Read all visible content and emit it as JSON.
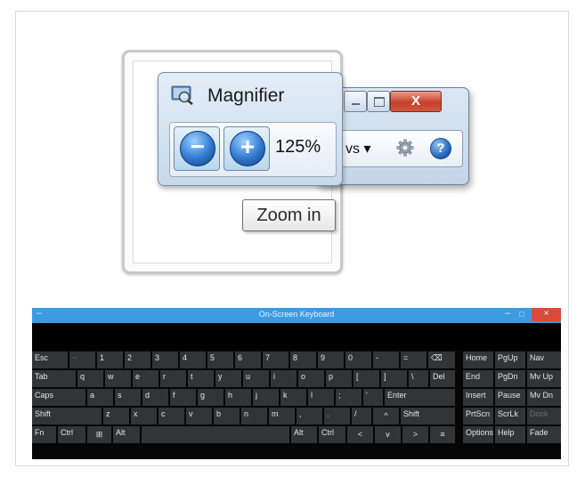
{
  "magnifier": {
    "title": "Magnifier",
    "zoom_level": "125%",
    "zoom_out_symbol": "−",
    "zoom_in_symbol": "+",
    "tooltip": "Zoom in",
    "views_label": "vs ▾",
    "close_symbol": "X",
    "help_symbol": "?",
    "icons": [
      "magnifier-app-icon",
      "gear-icon",
      "help-icon",
      "minimize-icon",
      "maximize-icon",
      "close-icon"
    ],
    "colors": {
      "close_button": "#c6402a",
      "zoom_orb": "#2f79cf",
      "window_frame": "#c7d9ec"
    }
  },
  "osk": {
    "title": "On-Screen Keyboard",
    "title_dash": "–",
    "minimize_symbol": "–",
    "maximize_symbol": "□",
    "close_symbol": "×",
    "colors": {
      "titlebar": "#3d9be1",
      "key": "#333436",
      "close": "#d94a3a"
    },
    "rows": [
      [
        "Esc",
        "~",
        "1",
        "2",
        "3",
        "4",
        "5",
        "6",
        "7",
        "8",
        "9",
        "0",
        "-",
        "=",
        "⌫"
      ],
      [
        "Tab",
        "q",
        "w",
        "e",
        "r",
        "t",
        "y",
        "u",
        "i",
        "o",
        "p",
        "[",
        "]",
        "\\",
        "Del"
      ],
      [
        "Caps",
        "a",
        "s",
        "d",
        "f",
        "g",
        "h",
        "j",
        "k",
        "l",
        ";",
        "'",
        "Enter"
      ],
      [
        "Shift",
        "z",
        "x",
        "c",
        "v",
        "b",
        "n",
        "m",
        ",",
        ".",
        "/",
        "^",
        "Shift"
      ],
      [
        "Fn",
        "Ctrl",
        "⊞",
        "Alt",
        "",
        "Alt",
        "Ctrl",
        "<",
        "v",
        ">",
        "≡"
      ]
    ],
    "nav_keys": [
      [
        "Home",
        "PgUp",
        "Nav"
      ],
      [
        "End",
        "PgDn",
        "Mv Up"
      ],
      [
        "Insert",
        "Pause",
        "Mv Dn"
      ],
      [
        "PrtScn",
        "ScrLk",
        "Dock"
      ],
      [
        "Options",
        "Help",
        "Fade"
      ]
    ]
  }
}
